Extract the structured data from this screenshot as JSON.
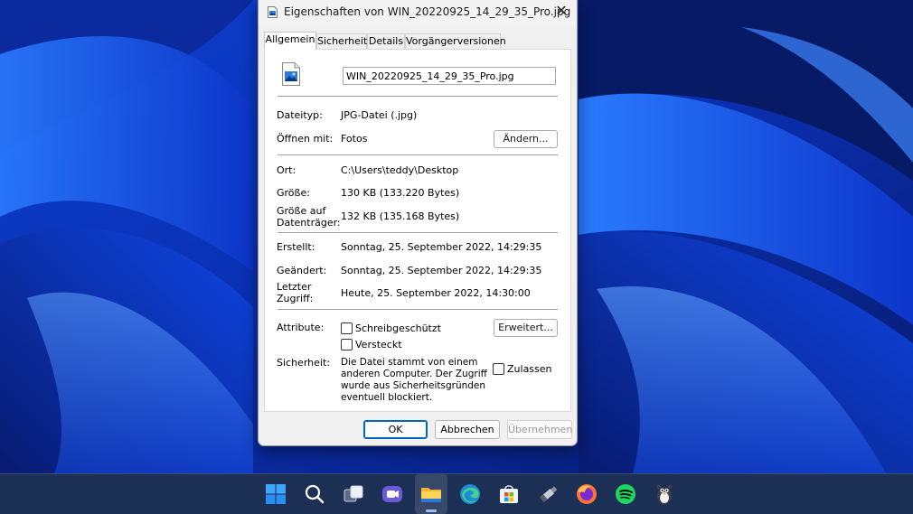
{
  "dialog": {
    "title": "Eigenschaften von WIN_20220925_14_29_35_Pro.jpg",
    "tabs": [
      "Allgemein",
      "Sicherheit",
      "Details",
      "Vorgängerversionen"
    ],
    "active_tab": "Allgemein",
    "filename": "WIN_20220925_14_29_35_Pro.jpg",
    "dateityp_label": "Dateityp:",
    "dateityp_value": "JPG-Datei (.jpg)",
    "oeffnen_label": "Öffnen mit:",
    "oeffnen_value": "Fotos",
    "aendern_button": "Ändern...",
    "ort_label": "Ort:",
    "ort_value": "C:\\Users\\teddy\\Desktop",
    "groesse_label": "Größe:",
    "groesse_value": "130 KB (133.220 Bytes)",
    "groesse_disk_label_1": "Größe auf",
    "groesse_disk_label_2": "Datenträger:",
    "groesse_disk_value": "132 KB (135.168 Bytes)",
    "erstellt_label": "Erstellt:",
    "erstellt_value": "Sonntag, 25. September 2022, 14:29:35",
    "geaendert_label": "Geändert:",
    "geaendert_value": "Sonntag, 25. September 2022, 14:29:35",
    "zugriff_label_1": "Letzter",
    "zugriff_label_2": "Zugriff:",
    "zugriff_value": "Heute, 25. September 2022, 14:30:00",
    "attribute_label": "Attribute:",
    "schreibgeschuetzt": "Schreibgeschützt",
    "versteckt": "Versteckt",
    "erweitert_button": "Erweitert...",
    "sicherheit_label": "Sicherheit:",
    "sicherheit_lines": [
      "Die Datei stammt von einem",
      "anderen Computer. Der Zugriff",
      "wurde aus Sicherheitsgründen",
      "eventuell blockiert."
    ],
    "zulassen": "Zulassen",
    "ok_button": "OK",
    "abbrechen_button": "Abbrechen",
    "uebernehmen_button": "Übernehmen",
    "close_symbol": "✕"
  },
  "taskbar": {
    "icons": [
      "windows-start-icon",
      "search-icon",
      "task-view-icon",
      "teams-chat-icon",
      "file-explorer-icon",
      "edge-icon",
      "microsoft-store-icon",
      "usb-drive-icon",
      "firefox-icon",
      "spotify-icon",
      "penguin-app-icon"
    ],
    "active": "file-explorer-icon"
  },
  "colors": {
    "accent": "#0067c0",
    "taskbar": "#1c2f54",
    "wallpaper_base": "#0a3fd6"
  }
}
